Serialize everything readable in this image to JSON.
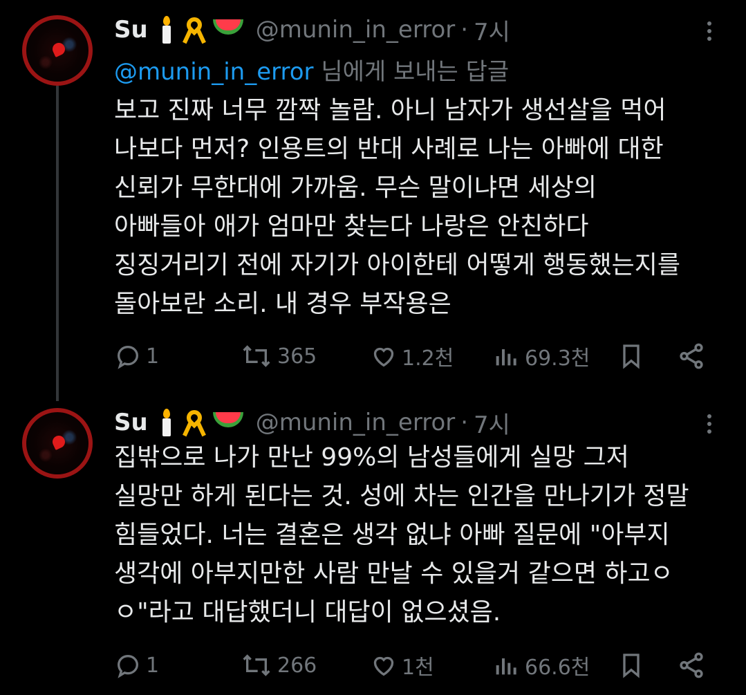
{
  "tweets": [
    {
      "author": {
        "name": "Su",
        "emojis": [
          "candle",
          "yellow-ribbon",
          "watermelon"
        ],
        "handle": "@munin_in_error",
        "separator": "·",
        "time": "7시"
      },
      "replying_to": {
        "mention": "@munin_in_error",
        "suffix": " 님에게 보내는 답글"
      },
      "lines": [
        "보고 진짜 너무 깜짝 놀람. 아니 남자가 생선살을 먹어",
        "나보다 먼저? 인용트의 반대 사례로 나는 아빠에 대한",
        "신뢰가 무한대에 가까움. 무슨 말이냐면 세상의",
        "아빠들아 애가 엄마만 찾는다 나랑은 안친하다",
        "징징거리기 전에 자기가 아이한테 어떻게 행동했는지를",
        "돌아보란 소리. 내 경우 부작용은"
      ],
      "actions": {
        "replies": "1",
        "reposts": "365",
        "likes": "1.2천",
        "views": "69.3천"
      }
    },
    {
      "author": {
        "name": "Su",
        "emojis": [
          "candle",
          "yellow-ribbon",
          "watermelon"
        ],
        "handle": "@munin_in_error",
        "separator": "·",
        "time": "7시"
      },
      "lines": [
        "집밖으로 나가 만난 99%의 남성들에게 실망 그저",
        "실망만 하게 된다는 것. 성에 차는 인간을 만나기가 정말",
        "힘들었다. 너는 결혼은 생각 없냐 아빠 질문에 \"아부지",
        "생각에 아부지만한 사람 만날 수 있을거 같으면 하고ㅇ",
        "ㅇ\"라고 대답했더니 대답이 없으셨음."
      ],
      "actions": {
        "replies": "1",
        "reposts": "266",
        "likes": "1천",
        "views": "66.6천"
      }
    }
  ],
  "colors": {
    "background": "#000000",
    "text": "#e7e9ea",
    "secondary": "#71767b",
    "mention": "#1d9bf0",
    "avatar_ring": "#9b1414"
  }
}
